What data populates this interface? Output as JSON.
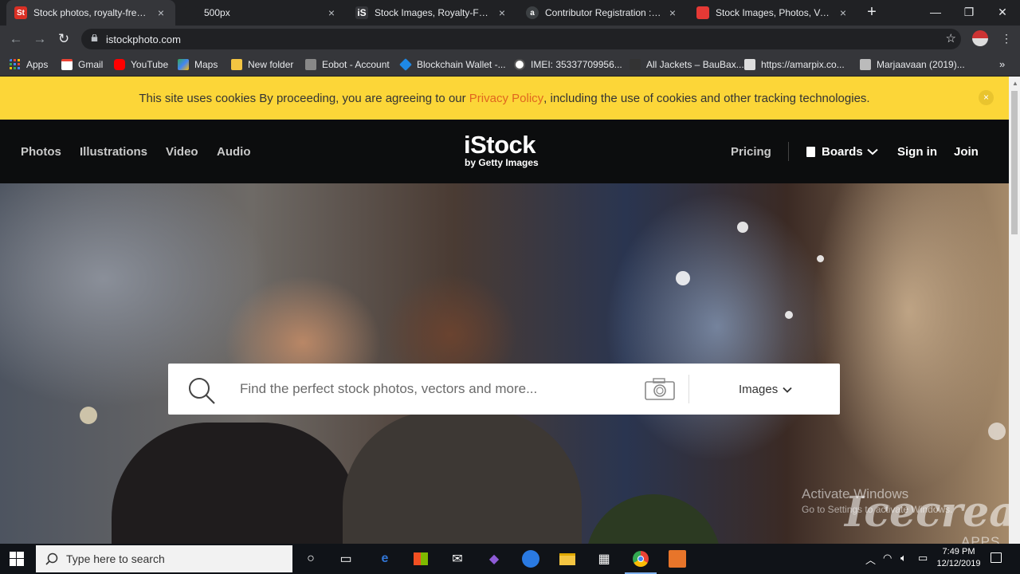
{
  "browser": {
    "tabs": [
      {
        "title": "Stock photos, royalty-free images",
        "favicon_color": "#d93025",
        "favicon_text": "St"
      },
      {
        "title": "500px",
        "favicon_color": "#202124",
        "favicon_text": ""
      },
      {
        "title": "Stock Images, Royalty-Free Pictures",
        "favicon_color": "#35363a",
        "favicon_text": "iS"
      },
      {
        "title": "Contributor Registration : Sign up",
        "favicon_color": "#3c4043",
        "favicon_text": "a"
      },
      {
        "title": "Stock Images, Photos, Vectors, Video",
        "favicon_color": "#e53935",
        "favicon_text": ""
      }
    ],
    "tab_close": "×",
    "new_tab": "+",
    "window": {
      "minimize": "—",
      "maximize": "❐",
      "close": "✕"
    },
    "nav": {
      "back": "←",
      "forward": "→",
      "reload": "↻"
    },
    "url": "istockphoto.com",
    "star": "☆",
    "bookmarks": [
      {
        "label": "Apps",
        "icon_color": "#4285f4"
      },
      {
        "label": "Gmail",
        "icon_color": "#ea4335"
      },
      {
        "label": "YouTube",
        "icon_color": "#ff0000"
      },
      {
        "label": "Maps",
        "icon_color": "#34a853"
      },
      {
        "label": "New folder",
        "icon_color": "#f4c542"
      },
      {
        "label": "Eobot - Account",
        "icon_color": "#888888"
      },
      {
        "label": "Blockchain Wallet -...",
        "icon_color": "#1e88e5"
      },
      {
        "label": "IMEI: 35337709956...",
        "icon_color": "#e8eaed"
      },
      {
        "label": "All Jackets – BauBax...",
        "icon_color": "#333333"
      },
      {
        "label": "https://amarpix.co...",
        "icon_color": "#dddddd"
      },
      {
        "label": "Marjaavaan (2019)...",
        "icon_color": "#bbbbbb"
      }
    ],
    "bookmarks_more": "»"
  },
  "cookie_banner": {
    "text_before": "This site uses cookies By proceeding, you are agreeing to our ",
    "link": "Privacy Policy",
    "text_after": ", including the use of cookies and other tracking technologies.",
    "close": "×"
  },
  "site_nav": {
    "left_links": [
      "Photos",
      "Illustrations",
      "Video",
      "Audio"
    ],
    "logo_main": "iStock",
    "logo_sub": "by Getty Images",
    "pricing": "Pricing",
    "boards": "Boards",
    "sign_in": "Sign in",
    "join": "Join"
  },
  "search": {
    "placeholder": "Find the perfect stock photos, vectors and more...",
    "scope": "Images"
  },
  "overlay": {
    "activate_title": "Activate Windows",
    "activate_sub": "Go to Settings to activate Windows.",
    "watermark": "Icecream",
    "watermark_sub": "APPS"
  },
  "taskbar": {
    "search_placeholder": "Type here to search",
    "time": "7:49 PM",
    "date": "12/12/2019"
  },
  "colors": {
    "cookie_bg": "#fcd638",
    "privacy_link": "#e0661f",
    "nav_bg": "#0c0d0e"
  }
}
